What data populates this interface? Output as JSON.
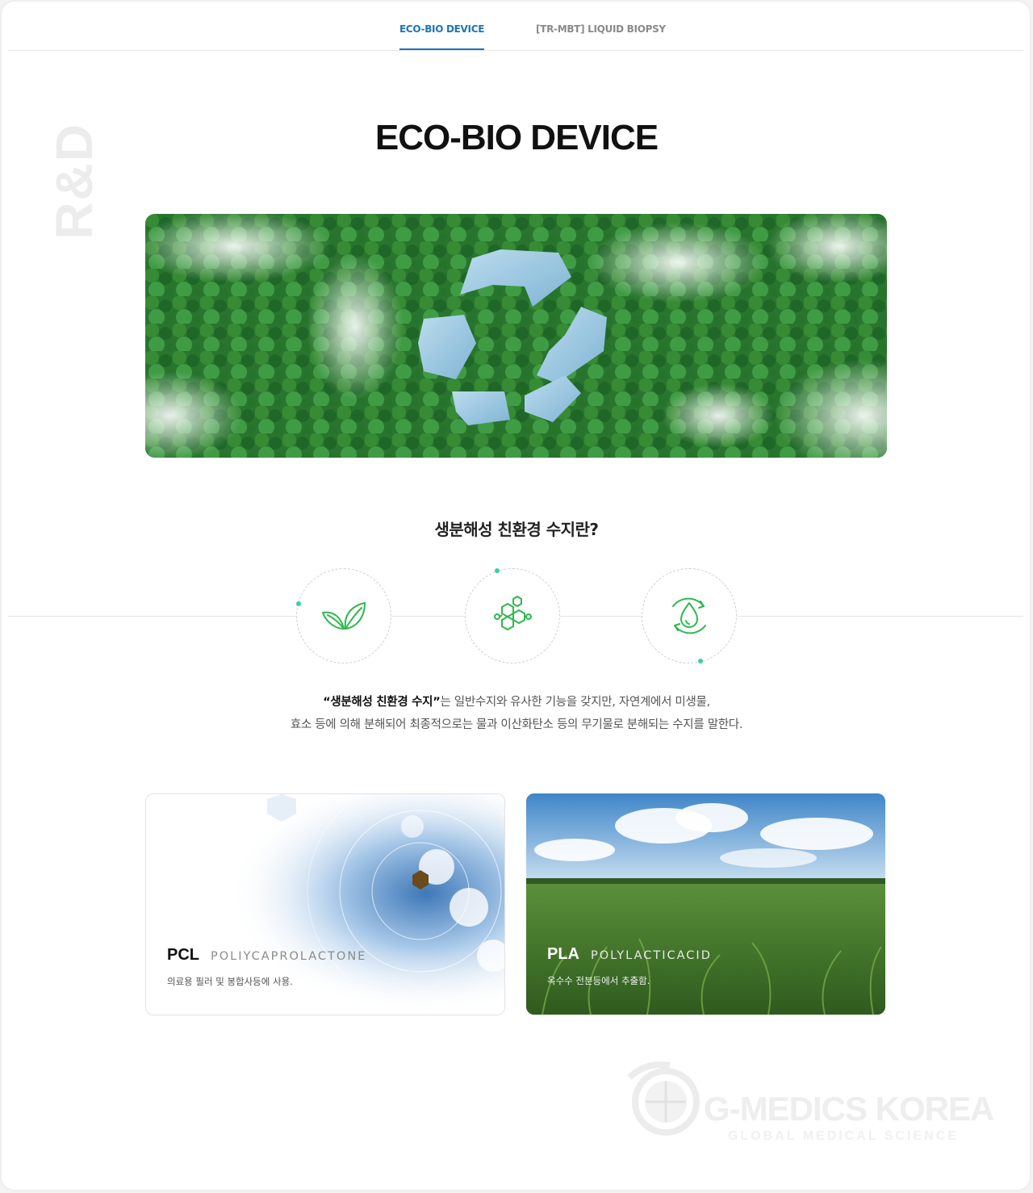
{
  "tabs": [
    {
      "label": "ECO-BIO DEVICE",
      "active": true
    },
    {
      "label": "[TR-MBT] LIQUID BIOPSY",
      "active": false
    }
  ],
  "side_label": "R&D",
  "page_title": "ECO-BIO DEVICE",
  "hero": {
    "icon": "recycle-forest-image"
  },
  "section": {
    "title": "생분해성 친환경 수지란?",
    "icons": [
      "leaf-icon",
      "molecule-icon",
      "water-drop-cycle-icon"
    ],
    "description_bold": "“생분해성 친환경 수지”",
    "description_line1_rest": "는 일반수지와 유사한 기능을 갖지만, 자연계에서 미생물,",
    "description_line2": "효소 등에 의해 분해되어 최종적으로는 물과 이산화탄소 등의 무기물로 분해되는 수지를 말한다."
  },
  "cards": [
    {
      "code": "PCL",
      "name": "POLIYCAPROLACTONE",
      "text": "의료용 필러 및 봉합사등에 사용."
    },
    {
      "code": "PLA",
      "name": "POLYLACTICACID",
      "text": "옥수수 전분등에서 추출함."
    }
  ],
  "watermark": {
    "title": "G-MEDICS KOREA",
    "subtitle": "GLOBAL MEDICAL SCIENCE"
  },
  "colors": {
    "accent": "#1f73b7",
    "icon_green": "#2db84d",
    "dot": "#37d39b"
  }
}
